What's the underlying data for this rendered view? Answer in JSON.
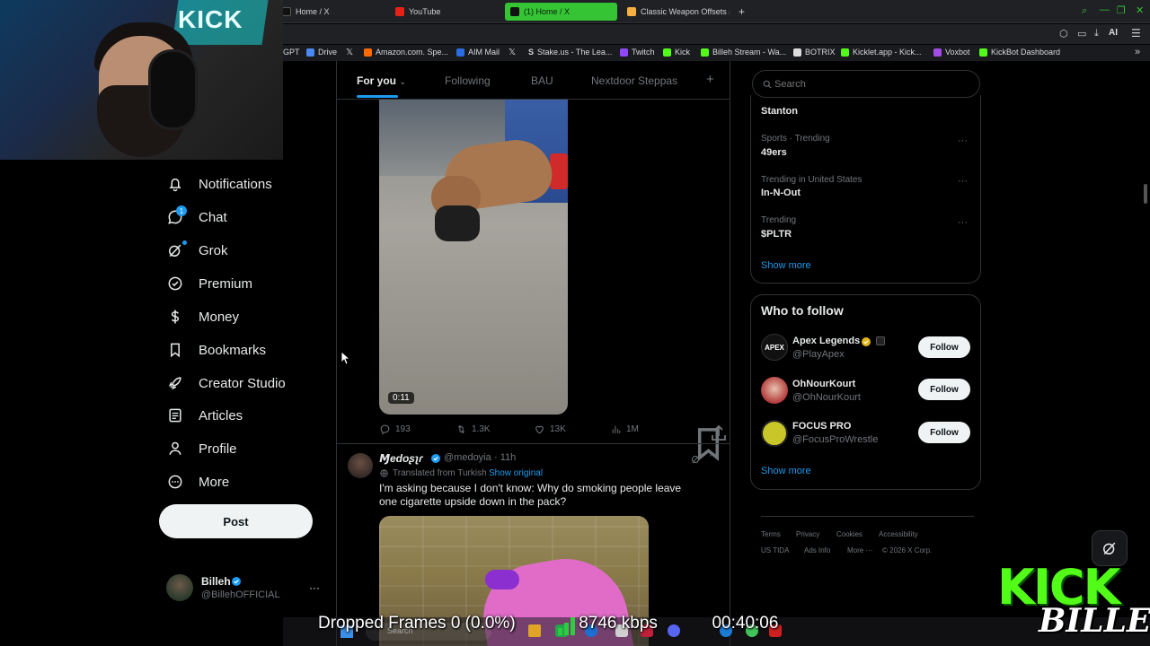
{
  "browser": {
    "tabs": [
      {
        "label": "Home / X",
        "fav": "#111",
        "active": false
      },
      {
        "label": "YouTube",
        "fav": "#e62117",
        "active": false
      },
      {
        "label": "(1) Home / X",
        "fav": "#111",
        "active": true
      },
      {
        "label": "Classic Weapon Offsets at",
        "fav": "#f5b041",
        "active": false
      }
    ],
    "new_tab": "+",
    "toolbar_ai": "AI",
    "bookmarks": [
      {
        "label": "GPT",
        "fav": "#6b6b6b"
      },
      {
        "label": "Drive",
        "fav": "#4a8af4"
      },
      {
        "label": "",
        "fav": "#ddd"
      },
      {
        "label": "Amazon.com. Spe...",
        "fav": "#ff9900"
      },
      {
        "label": "AIM Mail",
        "fav": "#2a6de0"
      },
      {
        "label": "",
        "fav": "#ddd"
      },
      {
        "label": "Stake.us - The Lea...",
        "fav": "#ddd"
      },
      {
        "label": "Twitch",
        "fav": "#9146ff"
      },
      {
        "label": "Kick",
        "fav": "#53fc18"
      },
      {
        "label": "Billeh Stream - Wa...",
        "fav": "#53fc18"
      },
      {
        "label": "BOTRIX",
        "fav": "#ddd"
      },
      {
        "label": "Kicklet.app - Kick...",
        "fav": "#53fc18"
      },
      {
        "label": "Voxbot",
        "fav": "#a24ee6"
      },
      {
        "label": "KickBot Dashboard",
        "fav": "#53fc18"
      }
    ]
  },
  "webcam": {
    "neon_text": "KICK"
  },
  "nav": {
    "items": [
      {
        "label": "Notifications",
        "icon": "bell-icon"
      },
      {
        "label": "Chat",
        "icon": "chat-icon",
        "badge": "1"
      },
      {
        "label": "Grok",
        "icon": "grok-icon"
      },
      {
        "label": "Premium",
        "icon": "premium-icon"
      },
      {
        "label": "Money",
        "icon": "money-icon"
      },
      {
        "label": "Bookmarks",
        "icon": "bookmark-icon"
      },
      {
        "label": "Creator Studio",
        "icon": "rocket-icon"
      },
      {
        "label": "Articles",
        "icon": "articles-icon"
      },
      {
        "label": "Profile",
        "icon": "person-icon"
      },
      {
        "label": "More",
        "icon": "more-circle-icon"
      }
    ],
    "post_label": "Post",
    "account": {
      "name": "Billeh",
      "handle": "@BillehOFFICIAL",
      "more": "···"
    }
  },
  "feed": {
    "tabs": [
      "For you",
      "Following",
      "BAU",
      "Nextdoor Steppas"
    ],
    "add_tab": "+",
    "tweet1": {
      "video_duration": "0:11",
      "replies": "193",
      "reposts": "1.3K",
      "likes": "13K",
      "views": "1M"
    },
    "tweet2": {
      "name": "Ɱedoʂʅɾ",
      "handle": "@medoyia",
      "time": "· 11h",
      "translated": "Translated from Turkish",
      "show_original": "Show original",
      "text": "I'm asking because I don't know: Why do smoking people leave one cigarette upside down in the pack?"
    }
  },
  "sidebar": {
    "search_placeholder": "Search",
    "trends": [
      {
        "meta": "",
        "name": "Stanton"
      },
      {
        "meta": "Sports · Trending",
        "name": "49ers"
      },
      {
        "meta": "Trending in United States",
        "name": "In-N-Out"
      },
      {
        "meta": "Trending",
        "name": "$PLTR"
      }
    ],
    "trends_show_more": "Show more",
    "who_to_follow_title": "Who to follow",
    "who_to_follow": [
      {
        "name": "Apex Legends",
        "handle": "@PlayApex",
        "button": "Follow"
      },
      {
        "name": "OhNourKourt",
        "handle": "@OhNourKourt",
        "button": "Follow"
      },
      {
        "name": "FOCUS PRO",
        "handle": "@FocusProWrestle",
        "button": "Follow"
      }
    ],
    "wtf_show_more": "Show more",
    "footer": [
      "Terms",
      "Privacy",
      "Cookies",
      "Accessibility",
      "US TIDA",
      "Ads Info",
      "More ···",
      "© 2026 X Corp."
    ]
  },
  "overlay": {
    "dropped_frames": "Dropped Frames 0 (0.0%)",
    "bitrate": "8746 kbps",
    "timer": "00:40:06",
    "kick_logo_top": "KICK",
    "kick_logo_bottom": "BILLEH",
    "taskbar_search": "Search"
  }
}
